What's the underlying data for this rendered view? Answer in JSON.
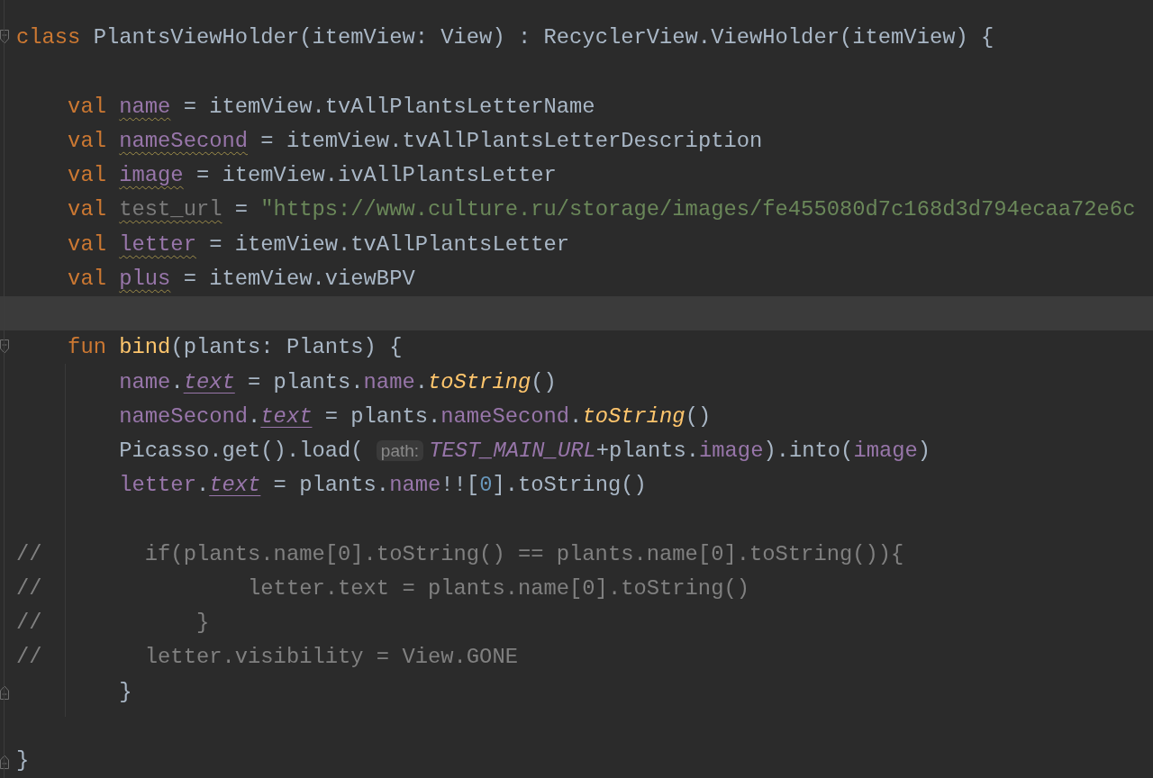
{
  "editor": {
    "lines": [
      {
        "kind": "fold_start",
        "current": false,
        "tokens": [
          {
            "text": "class ",
            "kind": "kw"
          },
          {
            "text": "PlantsViewHolder(itemView: View) : RecyclerView.ViewHolder(itemView) {",
            "kind": "plain"
          }
        ]
      },
      {
        "current": false
      },
      {
        "current": false,
        "tokens": [
          {
            "text": "    val ",
            "kind": "kw"
          },
          {
            "text": "name",
            "kind": "prop_warn"
          },
          {
            "text": " = itemView.tvAllPlantsLetterName",
            "kind": "plain"
          }
        ]
      },
      {
        "current": false,
        "tokens": [
          {
            "text": "    val ",
            "kind": "kw"
          },
          {
            "text": "nameSecond",
            "kind": "prop_warn"
          },
          {
            "text": " = itemView.tvAllPlantsLetterDescription",
            "kind": "plain"
          }
        ]
      },
      {
        "current": false,
        "tokens": [
          {
            "text": "    val ",
            "kind": "kw"
          },
          {
            "text": "image",
            "kind": "prop_warn"
          },
          {
            "text": " = itemView.ivAllPlantsLetter",
            "kind": "plain"
          }
        ]
      },
      {
        "current": false,
        "tokens": [
          {
            "text": "    val ",
            "kind": "kw"
          },
          {
            "text": "test_url",
            "kind": "unused_warn"
          },
          {
            "text": " = ",
            "kind": "plain"
          },
          {
            "text": "\"https://www.culture.ru/storage/images/fe455080d7c168d3d794ecaa72e6c",
            "kind": "str"
          }
        ]
      },
      {
        "current": false,
        "tokens": [
          {
            "text": "    val ",
            "kind": "kw"
          },
          {
            "text": "letter",
            "kind": "prop_warn"
          },
          {
            "text": " = itemView.tvAllPlantsLetter",
            "kind": "plain"
          }
        ]
      },
      {
        "current": false,
        "tokens": [
          {
            "text": "    val ",
            "kind": "kw"
          },
          {
            "text": "plus",
            "kind": "prop_warn"
          },
          {
            "text": " = itemView.viewBPV",
            "kind": "plain"
          }
        ]
      },
      {
        "current": true
      },
      {
        "kind": "fold_start",
        "current": false,
        "tokens": [
          {
            "text": "    fun ",
            "kind": "kw"
          },
          {
            "text": "bind",
            "kind": "fn"
          },
          {
            "text": "(plants: Plants) {",
            "kind": "plain"
          }
        ]
      },
      {
        "current": false,
        "tokens": [
          {
            "text": "        name",
            "kind": "prop"
          },
          {
            "text": ".",
            "kind": "plain"
          },
          {
            "text": "text",
            "kind": "synthetic"
          },
          {
            "text": " = plants.",
            "kind": "plain"
          },
          {
            "text": "name",
            "kind": "prop"
          },
          {
            "text": ".",
            "kind": "plain"
          },
          {
            "text": "toString",
            "kind": "ext_fn"
          },
          {
            "text": "()",
            "kind": "plain"
          }
        ]
      },
      {
        "current": false,
        "tokens": [
          {
            "text": "        nameSecond",
            "kind": "prop"
          },
          {
            "text": ".",
            "kind": "plain"
          },
          {
            "text": "text",
            "kind": "synthetic"
          },
          {
            "text": " = plants.",
            "kind": "plain"
          },
          {
            "text": "nameSecond",
            "kind": "prop"
          },
          {
            "text": ".",
            "kind": "plain"
          },
          {
            "text": "toString",
            "kind": "ext_fn"
          },
          {
            "text": "()",
            "kind": "plain"
          }
        ]
      },
      {
        "current": false,
        "tokens": [
          {
            "text": "        Picasso.get().load( ",
            "kind": "plain"
          },
          {
            "text": "path:",
            "kind": "hint"
          },
          {
            "text": "TEST_MAIN_URL",
            "kind": "const"
          },
          {
            "text": "+plants.",
            "kind": "plain"
          },
          {
            "text": "image",
            "kind": "prop"
          },
          {
            "text": ").into(",
            "kind": "plain"
          },
          {
            "text": "image",
            "kind": "prop"
          },
          {
            "text": ")",
            "kind": "plain"
          }
        ]
      },
      {
        "current": false,
        "tokens": [
          {
            "text": "        letter",
            "kind": "prop"
          },
          {
            "text": ".",
            "kind": "plain"
          },
          {
            "text": "text",
            "kind": "synthetic"
          },
          {
            "text": " = plants.",
            "kind": "plain"
          },
          {
            "text": "name",
            "kind": "prop"
          },
          {
            "text": "!![",
            "kind": "plain"
          },
          {
            "text": "0",
            "kind": "num"
          },
          {
            "text": "].toString()",
            "kind": "plain"
          }
        ]
      },
      {
        "current": false
      },
      {
        "current": false,
        "tokens": [
          {
            "text": "//        if(plants.name[0].toString() == plants.name[0].toString()){",
            "kind": "comment"
          }
        ]
      },
      {
        "current": false,
        "tokens": [
          {
            "text": "//                letter.text = plants.name[0].toString()",
            "kind": "comment"
          }
        ]
      },
      {
        "current": false,
        "tokens": [
          {
            "text": "//            }",
            "kind": "comment"
          }
        ]
      },
      {
        "current": false,
        "tokens": [
          {
            "text": "//        letter.visibility = View.GONE",
            "kind": "comment"
          }
        ]
      },
      {
        "kind": "fold_end",
        "current": false,
        "tokens": [
          {
            "text": "        }",
            "kind": "plain"
          }
        ]
      },
      {
        "current": false
      },
      {
        "kind": "fold_end",
        "current": false,
        "tokens": [
          {
            "text": "}",
            "kind": "plain"
          }
        ]
      }
    ]
  }
}
